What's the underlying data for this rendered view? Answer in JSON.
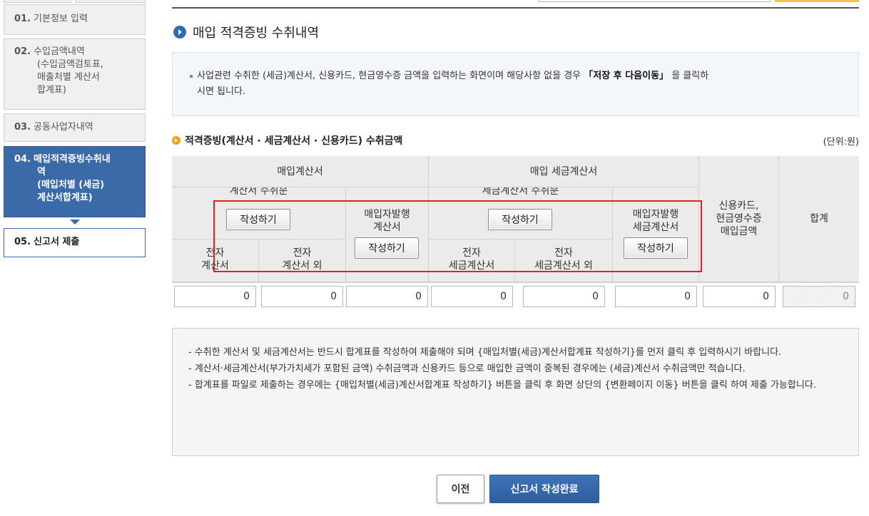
{
  "steps": [
    {
      "num": "01.",
      "label": "기본정보 입력",
      "cont": []
    },
    {
      "num": "02.",
      "label": "수입금액내역",
      "cont": [
        "(수입금액검토표,",
        "매출처별 계산서",
        "합계표)"
      ]
    },
    {
      "num": "03.",
      "label": "공동사업자내역",
      "cont": []
    },
    {
      "num": "04.",
      "label": "매입적격증빙수취내",
      "cont": [
        "역",
        "(매입처별 (세금)",
        "계산서합계표)"
      ]
    },
    {
      "num": "05.",
      "label": "신고서 제출",
      "cont": []
    }
  ],
  "page_title": "매입 적격증빙 수취내역",
  "info": {
    "line1_pre": "사업관련 수취한 (세금)계산서, 신용카드, 현금영수증 금액을 입력하는 화면이며 해당사항 없을 경우",
    "highlight": "「저장 후 다음이동」",
    "line1_post": "을 클릭하",
    "line2": "시면 됩니다."
  },
  "section_title": "적격증빙(계산서 · 세금계산서 · 신용카드) 수취금액",
  "unit": "(단위:원)",
  "grid": {
    "purchase_invoice": "매입계산서",
    "purchase_tax_invoice": "매입 세금계산서",
    "invoice_received": "계산서 수취분",
    "buyer_issued_invoice_1": "매입자발행",
    "buyer_issued_invoice_2": "계산서",
    "tax_invoice_received": "세금계산서 수취분",
    "buyer_issued_tax_1": "매입자발행",
    "buyer_issued_tax_2": "세금계산서",
    "card_1": "신용카드,",
    "card_2": "현금영수증",
    "card_3": "매입금액",
    "total": "합계",
    "e_invoice_1": "전자",
    "e_invoice_2": "계산서",
    "e_invoice_other_1": "전자",
    "e_invoice_other_2": "계산서 외",
    "e_tax_1": "전자",
    "e_tax_2": "세금계산서",
    "e_tax_other_1": "전자",
    "e_tax_other_2": "세금계산서 외",
    "write_label": "작성하기"
  },
  "values": [
    "0",
    "0",
    "0",
    "0",
    "0",
    "0",
    "0",
    "0"
  ],
  "notes": [
    "- 수취한 계산서 및 세금계산서는 반드시 합계표를 작성하여 제출해야 되며 {매입처별(세금)계산서합계표 작성하기}를 먼저 클릭 후 입력하시기 바랍니다.",
    "- 계산서·세금계산서(부가가치세가 포함된 금액) 수취금액과 신용카드 등으로 매입한 금액이 중복된 경우에는 (세금)계산서 수취금액만 적습니다.",
    "- 합계표를 파일로 제출하는 경우에는 {매입처별(세금)계산서합계표 작성하기} 버튼을 클릭 후 화면 상단의 {변환페이지 이동} 버튼을 클릭 하여 제출 가능합니다."
  ],
  "buttons": {
    "prev": "이전",
    "done": "신고서 작성완료"
  }
}
